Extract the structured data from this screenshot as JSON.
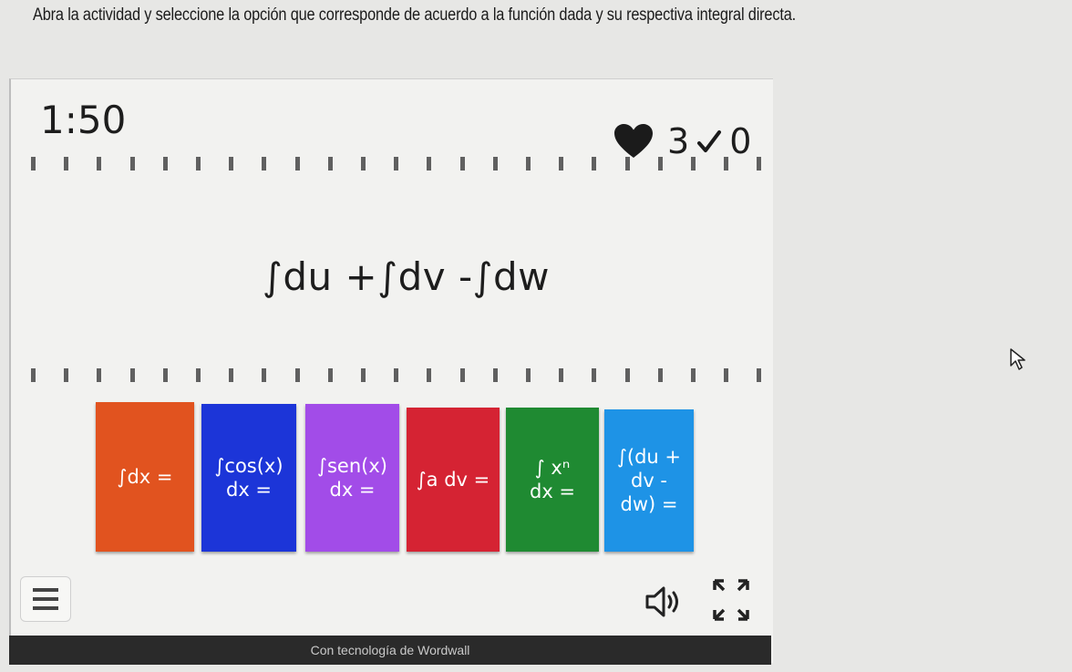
{
  "instruction": "Abra la actividad y seleccione la opción que corresponde de acuerdo a la función dada y su respectiva integral directa.",
  "game": {
    "timer": "1:50",
    "lives": "3",
    "score": "0",
    "question": "∫du +∫dv -∫dw",
    "answers": [
      {
        "label": "∫dx =",
        "color": "#e1531f"
      },
      {
        "label": "∫cos(x)\ndx =",
        "color": "#1c35d8"
      },
      {
        "label": "∫sen(x)\ndx =",
        "color": "#a24ce8"
      },
      {
        "label": "∫a dv =",
        "color": "#d52333"
      },
      {
        "label": "∫ xⁿ\ndx =",
        "color": "#1f8a32"
      },
      {
        "label": "∫(du +\ndv -\ndw) =",
        "color": "#1e93e6"
      }
    ],
    "footer": "Con tecnología de Wordwall"
  },
  "icons": {
    "heart": "heart-icon",
    "check": "check-icon",
    "menu": "menu-icon",
    "sound": "sound-icon",
    "fullscreen": "fullscreen-icon",
    "cursor": "cursor-icon"
  }
}
